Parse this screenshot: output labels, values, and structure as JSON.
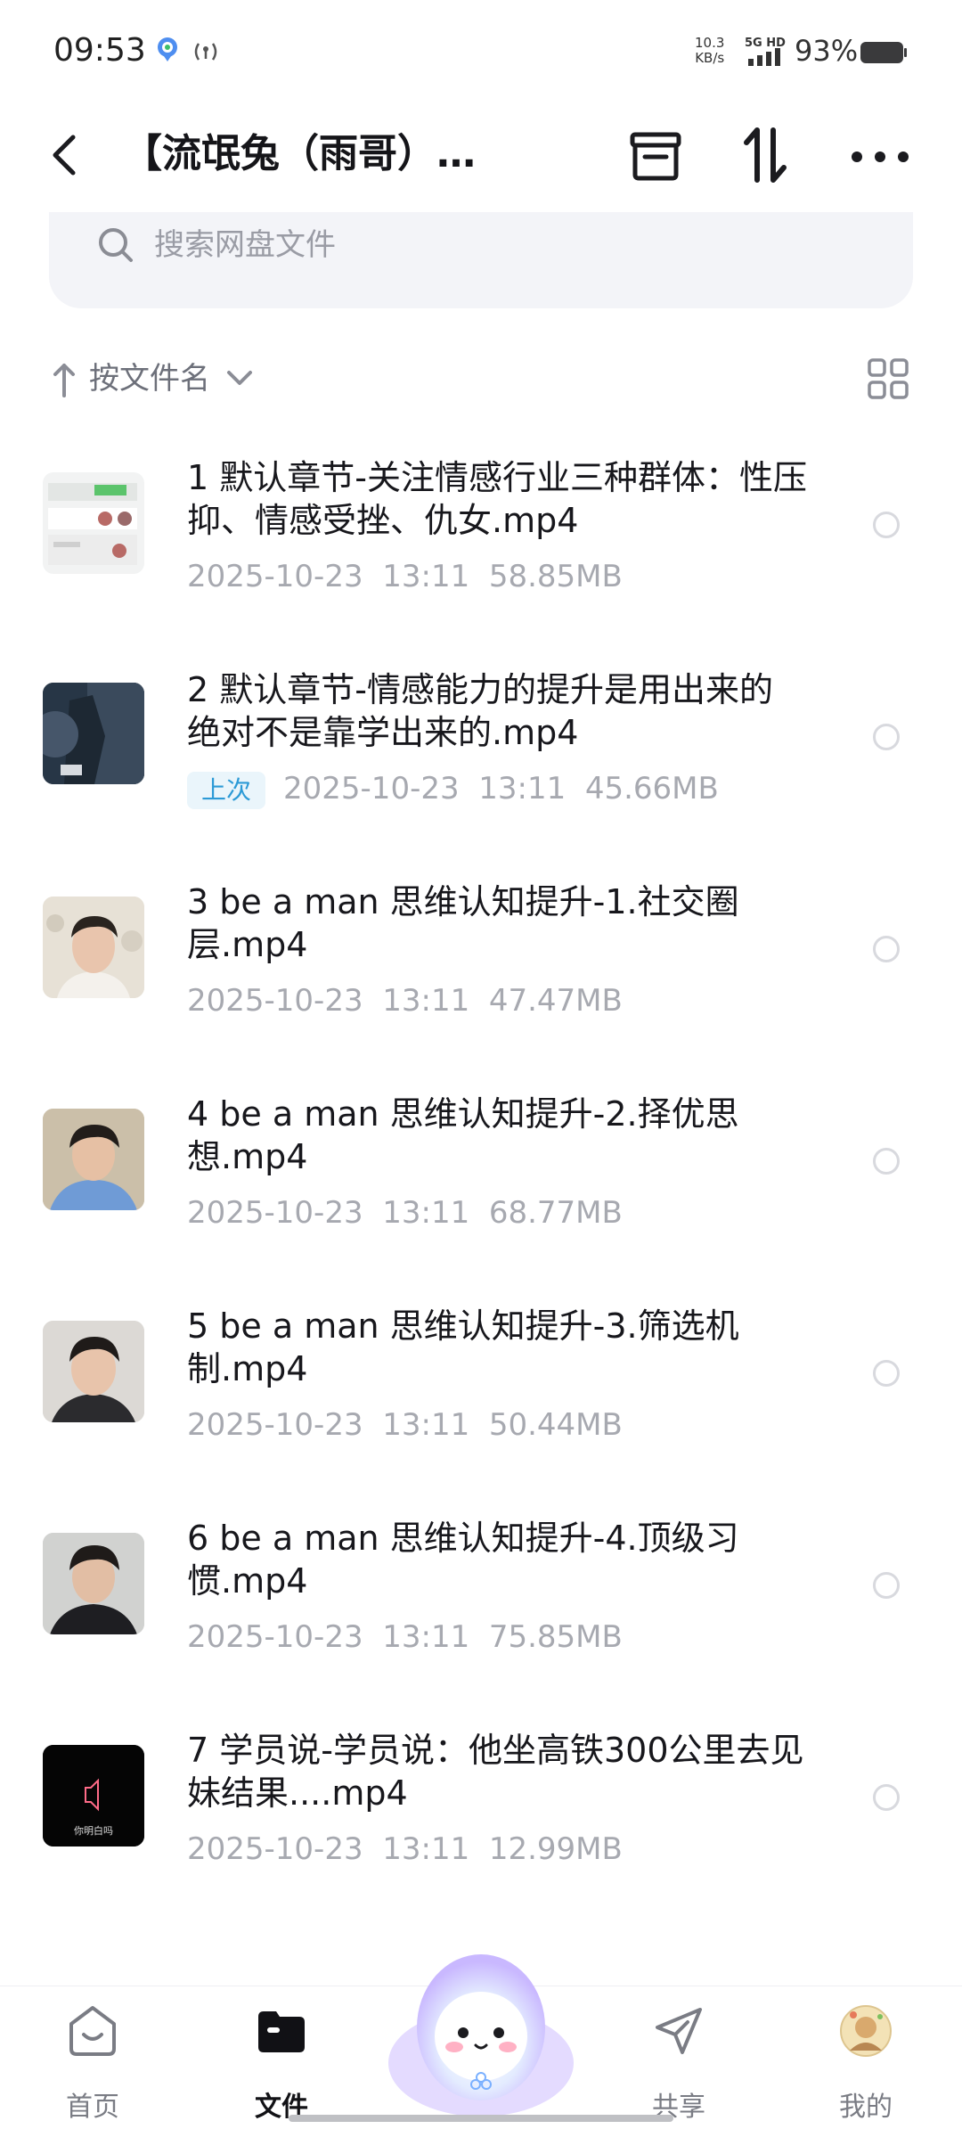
{
  "status_bar": {
    "time": "09:53",
    "speed_value": "10.3",
    "speed_unit": "KB/s",
    "network": "5G HD",
    "battery": "93%"
  },
  "header": {
    "title": "【流氓兔（雨哥）…",
    "icons": [
      "back-icon",
      "archive-icon",
      "sort-transfer-icon",
      "more-icon"
    ]
  },
  "search": {
    "placeholder": "搜索网盘文件"
  },
  "sort": {
    "label": "按文件名"
  },
  "files": [
    {
      "name": "1 默认章节-关注情感行业三种群体：性压抑、情感受挫、仇女.mp4",
      "date": "2025-10-23",
      "time": "13:11",
      "size": "58.85MB",
      "badge": ""
    },
    {
      "name": "2 默认章节-情感能力的提升是用出来的 绝对不是靠学出来的.mp4",
      "date": "2025-10-23",
      "time": "13:11",
      "size": "45.66MB",
      "badge": "上次"
    },
    {
      "name": "3 be a man 思维认知提升-1.社交圈层.mp4",
      "date": "2025-10-23",
      "time": "13:11",
      "size": "47.47MB",
      "badge": ""
    },
    {
      "name": "4 be a man 思维认知提升-2.择优思想.mp4",
      "date": "2025-10-23",
      "time": "13:11",
      "size": "68.77MB",
      "badge": ""
    },
    {
      "name": "5 be a man 思维认知提升-3.筛选机制.mp4",
      "date": "2025-10-23",
      "time": "13:11",
      "size": "50.44MB",
      "badge": ""
    },
    {
      "name": "6 be a man 思维认知提升-4.顶级习惯.mp4",
      "date": "2025-10-23",
      "time": "13:11",
      "size": "75.85MB",
      "badge": ""
    },
    {
      "name": "7 学员说-学员说：他坐高铁300公里去见妹结果....mp4",
      "date": "2025-10-23",
      "time": "13:11",
      "size": "12.99MB",
      "badge": ""
    }
  ],
  "thumb7_caption": "你明白吗",
  "nav": {
    "home": "首页",
    "files": "文件",
    "share": "共享",
    "me": "我的"
  },
  "colors": {
    "accent": "#2c9ad6",
    "meta": "#a7a9b0"
  }
}
